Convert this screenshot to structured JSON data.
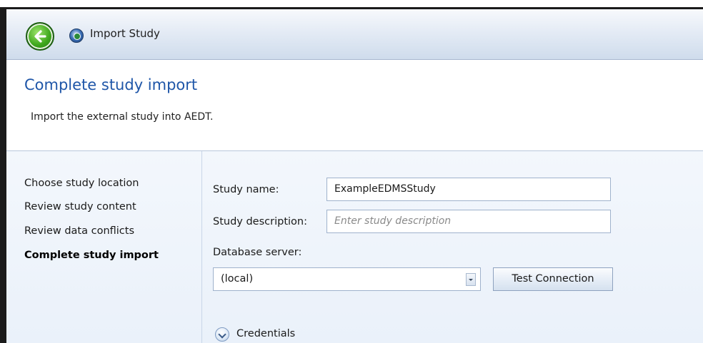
{
  "window": {
    "title": "Import Study"
  },
  "header": {
    "title": "Complete study import",
    "subtitle": "Import the external study into AEDT."
  },
  "steps": [
    {
      "label": "Choose study location",
      "current": false
    },
    {
      "label": "Review study content",
      "current": false
    },
    {
      "label": "Review data conflicts",
      "current": false
    },
    {
      "label": "Complete study import",
      "current": true
    }
  ],
  "form": {
    "study_name": {
      "label": "Study name:",
      "value": "ExampleEDMSStudy"
    },
    "study_description": {
      "label": "Study description:",
      "value": "",
      "placeholder": "Enter study description"
    },
    "database_server": {
      "label": "Database server:",
      "value": "(local)"
    },
    "test_connection_label": "Test Connection",
    "credentials_label": "Credentials"
  },
  "icons": {
    "back": "back-arrow-icon",
    "app": "app-globe-icon",
    "dropdown": "chevron-down-icon",
    "expander": "expand-chevron-icon"
  },
  "colors": {
    "title_blue": "#1f56a8",
    "back_green": "#3ea71c"
  }
}
